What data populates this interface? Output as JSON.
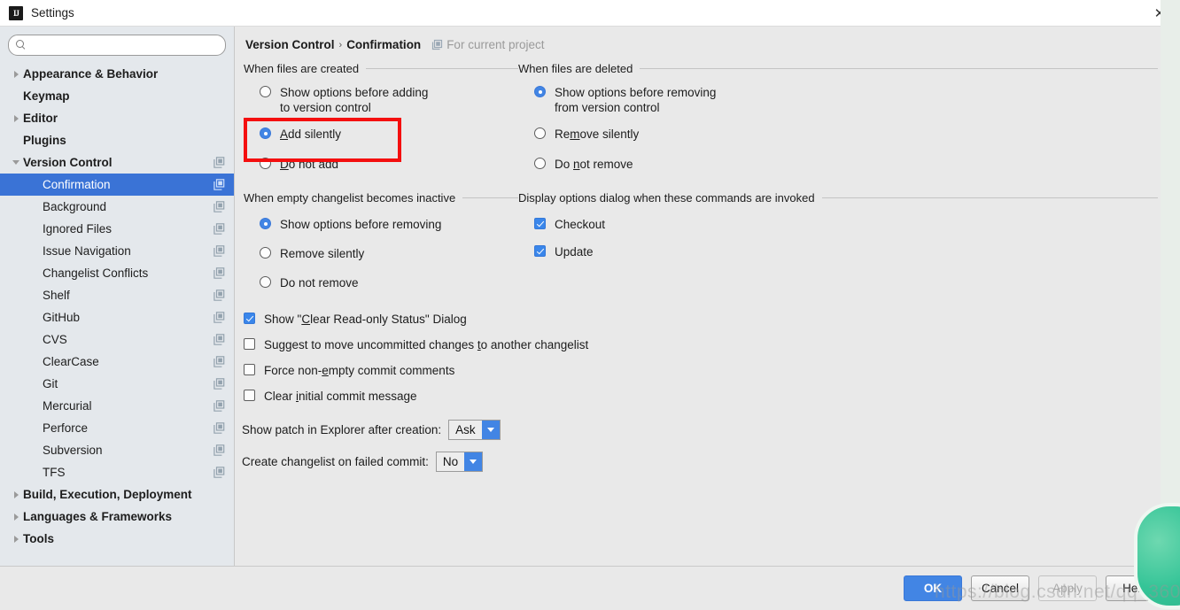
{
  "window": {
    "title": "Settings",
    "app_icon": "IJ",
    "close_icon": "✕"
  },
  "sidebar": {
    "search": {
      "value": "",
      "placeholder": ""
    },
    "items": [
      {
        "label": "Appearance & Behavior",
        "level": "top",
        "arrow": "right",
        "bold": true,
        "copy": false,
        "selected": false
      },
      {
        "label": "Keymap",
        "level": "top",
        "arrow": "none",
        "bold": true,
        "copy": false,
        "selected": false
      },
      {
        "label": "Editor",
        "level": "top",
        "arrow": "right",
        "bold": true,
        "copy": false,
        "selected": false
      },
      {
        "label": "Plugins",
        "level": "top",
        "arrow": "none",
        "bold": true,
        "copy": false,
        "selected": false
      },
      {
        "label": "Version Control",
        "level": "top",
        "arrow": "down",
        "bold": true,
        "copy": true,
        "selected": false
      },
      {
        "label": "Confirmation",
        "level": "child",
        "arrow": "none",
        "bold": false,
        "copy": true,
        "selected": true
      },
      {
        "label": "Background",
        "level": "child",
        "arrow": "none",
        "bold": false,
        "copy": true,
        "selected": false
      },
      {
        "label": "Ignored Files",
        "level": "child",
        "arrow": "none",
        "bold": false,
        "copy": true,
        "selected": false
      },
      {
        "label": "Issue Navigation",
        "level": "child",
        "arrow": "none",
        "bold": false,
        "copy": true,
        "selected": false
      },
      {
        "label": "Changelist Conflicts",
        "level": "child",
        "arrow": "none",
        "bold": false,
        "copy": true,
        "selected": false
      },
      {
        "label": "Shelf",
        "level": "child",
        "arrow": "none",
        "bold": false,
        "copy": true,
        "selected": false
      },
      {
        "label": "GitHub",
        "level": "child",
        "arrow": "none",
        "bold": false,
        "copy": true,
        "selected": false
      },
      {
        "label": "CVS",
        "level": "child",
        "arrow": "none",
        "bold": false,
        "copy": true,
        "selected": false
      },
      {
        "label": "ClearCase",
        "level": "child",
        "arrow": "none",
        "bold": false,
        "copy": true,
        "selected": false
      },
      {
        "label": "Git",
        "level": "child",
        "arrow": "none",
        "bold": false,
        "copy": true,
        "selected": false
      },
      {
        "label": "Mercurial",
        "level": "child",
        "arrow": "none",
        "bold": false,
        "copy": true,
        "selected": false
      },
      {
        "label": "Perforce",
        "level": "child",
        "arrow": "none",
        "bold": false,
        "copy": true,
        "selected": false
      },
      {
        "label": "Subversion",
        "level": "child",
        "arrow": "none",
        "bold": false,
        "copy": true,
        "selected": false
      },
      {
        "label": "TFS",
        "level": "child",
        "arrow": "none",
        "bold": false,
        "copy": true,
        "selected": false
      },
      {
        "label": "Build, Execution, Deployment",
        "level": "top",
        "arrow": "right",
        "bold": true,
        "copy": false,
        "selected": false
      },
      {
        "label": "Languages & Frameworks",
        "level": "top",
        "arrow": "right",
        "bold": true,
        "copy": false,
        "selected": false
      },
      {
        "label": "Tools",
        "level": "top",
        "arrow": "right",
        "bold": true,
        "copy": false,
        "selected": false
      }
    ]
  },
  "breadcrumb": {
    "root": "Version Control",
    "separator": "›",
    "leaf": "Confirmation",
    "scope_label": "For current project"
  },
  "sections": {
    "created": {
      "title": "When files are created",
      "options": [
        {
          "label_a": "Show options before adding",
          "label_b": "to version control",
          "checked": false
        },
        {
          "label_a": "Add silently",
          "label_b": "",
          "checked": true,
          "mnemonic": "A"
        },
        {
          "label_a": "Do not add",
          "label_b": "",
          "checked": false,
          "mnemonic": "D"
        }
      ]
    },
    "deleted": {
      "title": "When files are deleted",
      "options": [
        {
          "label_a": "Show options before removing",
          "label_b": "from version control",
          "checked": true
        },
        {
          "label_a": "Remove silently",
          "label_b": "",
          "checked": false
        },
        {
          "label_a": "Do not remove",
          "label_b": "",
          "checked": false
        }
      ]
    },
    "empty_changelist": {
      "title": "When empty changelist becomes inactive",
      "options": [
        {
          "label_a": "Show options before removing",
          "checked": true
        },
        {
          "label_a": "Remove silently",
          "checked": false
        },
        {
          "label_a": "Do not remove",
          "checked": false
        }
      ]
    },
    "display_options": {
      "title": "Display options dialog when these commands are invoked",
      "checkboxes": [
        {
          "label": "Checkout",
          "checked": true
        },
        {
          "label": "Update",
          "checked": true
        }
      ]
    }
  },
  "checkboxes": [
    {
      "label": "Show \"Clear Read-only Status\" Dialog",
      "checked": true
    },
    {
      "label": "Suggest to move uncommitted changes to another changelist",
      "checked": false
    },
    {
      "label": "Force non-empty commit comments",
      "checked": false
    },
    {
      "label": "Clear initial commit message",
      "checked": false
    }
  ],
  "combos": [
    {
      "label": "Show patch in Explorer after creation:",
      "value": "Ask"
    },
    {
      "label": "Create changelist on failed commit:",
      "value": "No"
    }
  ],
  "footer": {
    "ok": "OK",
    "cancel": "Cancel",
    "apply": "Apply",
    "help": "Help"
  },
  "overlay": {
    "watermark": "https://blog.csdn.net/qq_36010496",
    "annotation_color": "#f40f0f"
  }
}
